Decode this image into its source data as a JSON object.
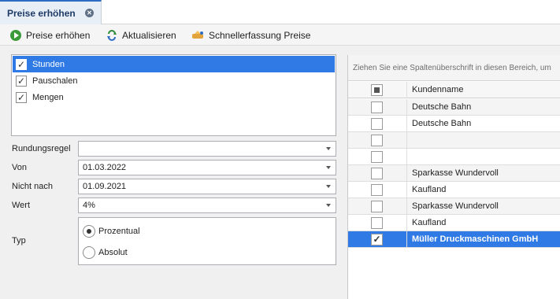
{
  "tab": {
    "label": "Preise erhöhen",
    "close": "✕"
  },
  "toolbar": {
    "buttons": [
      {
        "label": "Preise erhöhen",
        "icon": "play-icon"
      },
      {
        "label": "Aktualisieren",
        "icon": "refresh-icon"
      },
      {
        "label": "Schnellerfassung Preise",
        "icon": "quick-entry-icon"
      }
    ]
  },
  "types": [
    {
      "label": "Stunden",
      "checked": true,
      "selected": true
    },
    {
      "label": "Pauschalen",
      "checked": true,
      "selected": false
    },
    {
      "label": "Mengen",
      "checked": true,
      "selected": false
    }
  ],
  "form": {
    "rundung": {
      "label": "Rundungsregel",
      "value": ""
    },
    "von": {
      "label": "Von",
      "value": "01.03.2022"
    },
    "nicht_nach": {
      "label": "Nicht nach",
      "value": "01.09.2021"
    },
    "wert": {
      "label": "Wert",
      "value": "4%"
    },
    "typ": {
      "label": "Typ",
      "options": [
        "Prozentual",
        "Absolut"
      ],
      "selected": "Prozentual"
    }
  },
  "grid": {
    "group_hint": "Ziehen Sie eine Spaltenüberschrift in diesen Bereich, um",
    "column_header": "Kundenname",
    "rows": [
      {
        "name": "Deutsche Bahn",
        "checked": false
      },
      {
        "name": "Deutsche Bahn",
        "checked": false
      },
      {
        "name": "",
        "checked": false
      },
      {
        "name": "",
        "checked": false
      },
      {
        "name": "Sparkasse Wundervoll",
        "checked": false
      },
      {
        "name": "Kaufland",
        "checked": false
      },
      {
        "name": "Sparkasse Wundervoll",
        "checked": false
      },
      {
        "name": "Kaufland",
        "checked": false
      },
      {
        "name": "Müller Druckmaschinen GmbH",
        "checked": true,
        "selected": true
      }
    ]
  },
  "colors": {
    "accent": "#2f7ae5",
    "tab_border": "#2b6cc4"
  }
}
